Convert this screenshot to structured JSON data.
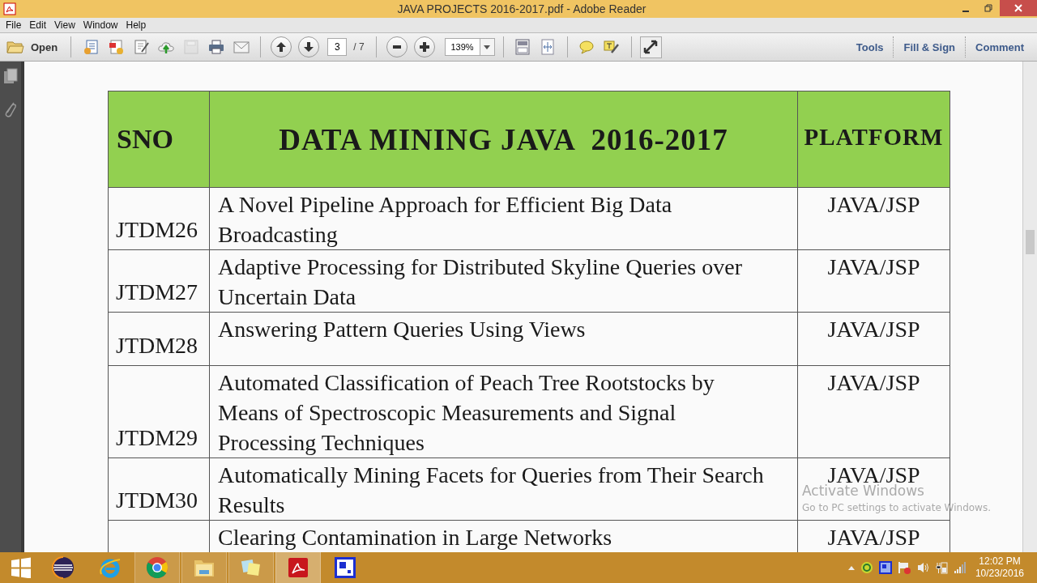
{
  "window": {
    "title": "JAVA PROJECTS 2016-2017.pdf - Adobe Reader"
  },
  "menu": [
    "File",
    "Edit",
    "View",
    "Window",
    "Help"
  ],
  "toolbar": {
    "open_label": "Open",
    "tools": [
      {
        "kind": "create",
        "disabled": false
      },
      {
        "kind": "convert",
        "disabled": false
      },
      {
        "kind": "edit",
        "disabled": false
      },
      {
        "kind": "upload",
        "disabled": false
      },
      {
        "kind": "save",
        "disabled": true
      },
      {
        "kind": "print",
        "disabled": false
      },
      {
        "kind": "email",
        "disabled": false
      }
    ],
    "page_number": "3",
    "page_total": "/ 7",
    "zoom": "139%",
    "panels": [
      "Tools",
      "Fill & Sign",
      "Comment"
    ]
  },
  "table": {
    "columns": [
      "SNO",
      "DATA MINING JAVA  2016-2017",
      "PLATFORM"
    ],
    "rows": [
      {
        "sno": "JTDM26",
        "title": "A Novel Pipeline Approach for Efficient Big Data Broadcasting",
        "platform": "JAVA/JSP"
      },
      {
        "sno": "JTDM27",
        "title": "Adaptive Processing for Distributed Skyline Queries over Uncertain Data",
        "platform": "JAVA/JSP"
      },
      {
        "sno": "JTDM28",
        "title": "Answering Pattern Queries Using Views",
        "platform": "JAVA/JSP"
      },
      {
        "sno": "JTDM29",
        "title": "Automated Classification of Peach Tree Rootstocks by Means of Spectroscopic Measurements and Signal Processing Techniques",
        "platform": "JAVA/JSP"
      },
      {
        "sno": "JTDM30",
        "title": "Automatically Mining Facets for Queries from Their Search Results",
        "platform": "JAVA/JSP"
      },
      {
        "sno": "",
        "title": "Clearing Contamination in Large Networks",
        "platform": "JAVA/JSP"
      }
    ]
  },
  "activation_notice": {
    "title": "Activate Windows",
    "message": "Go to PC settings to activate Windows."
  },
  "taskbar": {
    "apps": [
      {
        "kind": "eclipse",
        "running": false,
        "selected": false
      },
      {
        "kind": "browser-e",
        "running": false,
        "selected": false
      },
      {
        "kind": "chrome",
        "running": true,
        "selected": false
      },
      {
        "kind": "folder",
        "running": true,
        "selected": false
      },
      {
        "kind": "notes",
        "running": true,
        "selected": false
      },
      {
        "kind": "pdf",
        "running": true,
        "selected": true
      },
      {
        "kind": "window",
        "running": false,
        "selected": false
      }
    ],
    "time": "12:02 PM",
    "date": "10/23/2016"
  }
}
